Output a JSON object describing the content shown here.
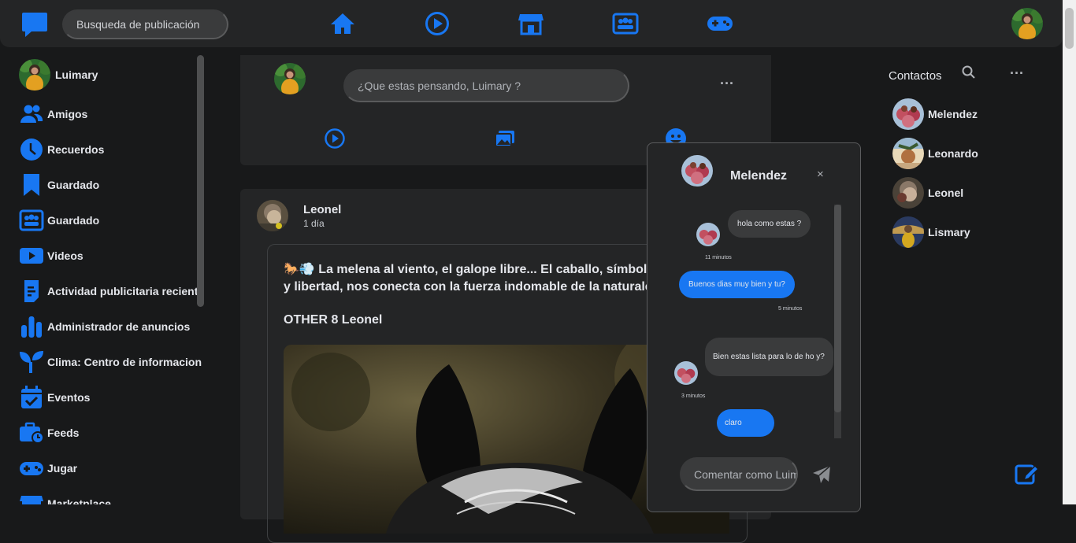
{
  "header": {
    "search_placeholder": "Busqueda de publicación",
    "nav_icons": [
      "home-icon",
      "video-play-icon",
      "marketplace-store-icon",
      "groups-icon",
      "gaming-icon"
    ]
  },
  "sidebar": {
    "items": [
      {
        "label": "Luimary",
        "icon": "user-avatar"
      },
      {
        "label": "Amigos",
        "icon": "friends-icon"
      },
      {
        "label": "Recuerdos",
        "icon": "clock-icon"
      },
      {
        "label": "Guardado",
        "icon": "bookmark-icon"
      },
      {
        "label": "Guardado",
        "icon": "groups-icon"
      },
      {
        "label": "Videos",
        "icon": "video-icon"
      },
      {
        "label": "Actividad publicitaria reciente",
        "icon": "ad-activity-icon"
      },
      {
        "label": "Administrador de anuncios",
        "icon": "bar-chart-icon"
      },
      {
        "label": "Clima: Centro de informacion",
        "icon": "sprout-icon"
      },
      {
        "label": "Eventos",
        "icon": "calendar-icon"
      },
      {
        "label": "Feeds",
        "icon": "briefcase-clock-icon"
      },
      {
        "label": "Jugar",
        "icon": "gamepad-icon"
      },
      {
        "label": "Marketplace",
        "icon": "store-icon"
      }
    ]
  },
  "composer": {
    "placeholder": "¿Que estas pensando, Luimary ?",
    "more": "···"
  },
  "post": {
    "author": "Leonel",
    "time": "1 día",
    "text": "🐎💨 La melena al viento, el galope libre... El caballo, símbolo de nobleza y libertad, nos conecta con la fuerza indomable de la naturaleza",
    "subtext": "OTHER 8 Leonel"
  },
  "contacts": {
    "title": "Contactos",
    "more": "···",
    "list": [
      "Melendez",
      "Leonardo",
      "Leonel",
      "Lismary"
    ]
  },
  "chat": {
    "name": "Melendez",
    "close": "×",
    "messages": [
      {
        "from": "them",
        "text": "hola como estas ?",
        "time": "11 minutos"
      },
      {
        "from": "me",
        "text": "Buenos dias muy bien y tu?",
        "time": "5 minutos"
      },
      {
        "from": "them",
        "text": "Bien estas lista para lo de ho y?",
        "time": "3 minutos"
      },
      {
        "from": "me",
        "text": "claro",
        "time": ""
      }
    ],
    "input_placeholder": "Comentar como Luimary"
  },
  "colors": {
    "accent": "#1877f2",
    "background": "#18191a",
    "panel": "#242526"
  }
}
